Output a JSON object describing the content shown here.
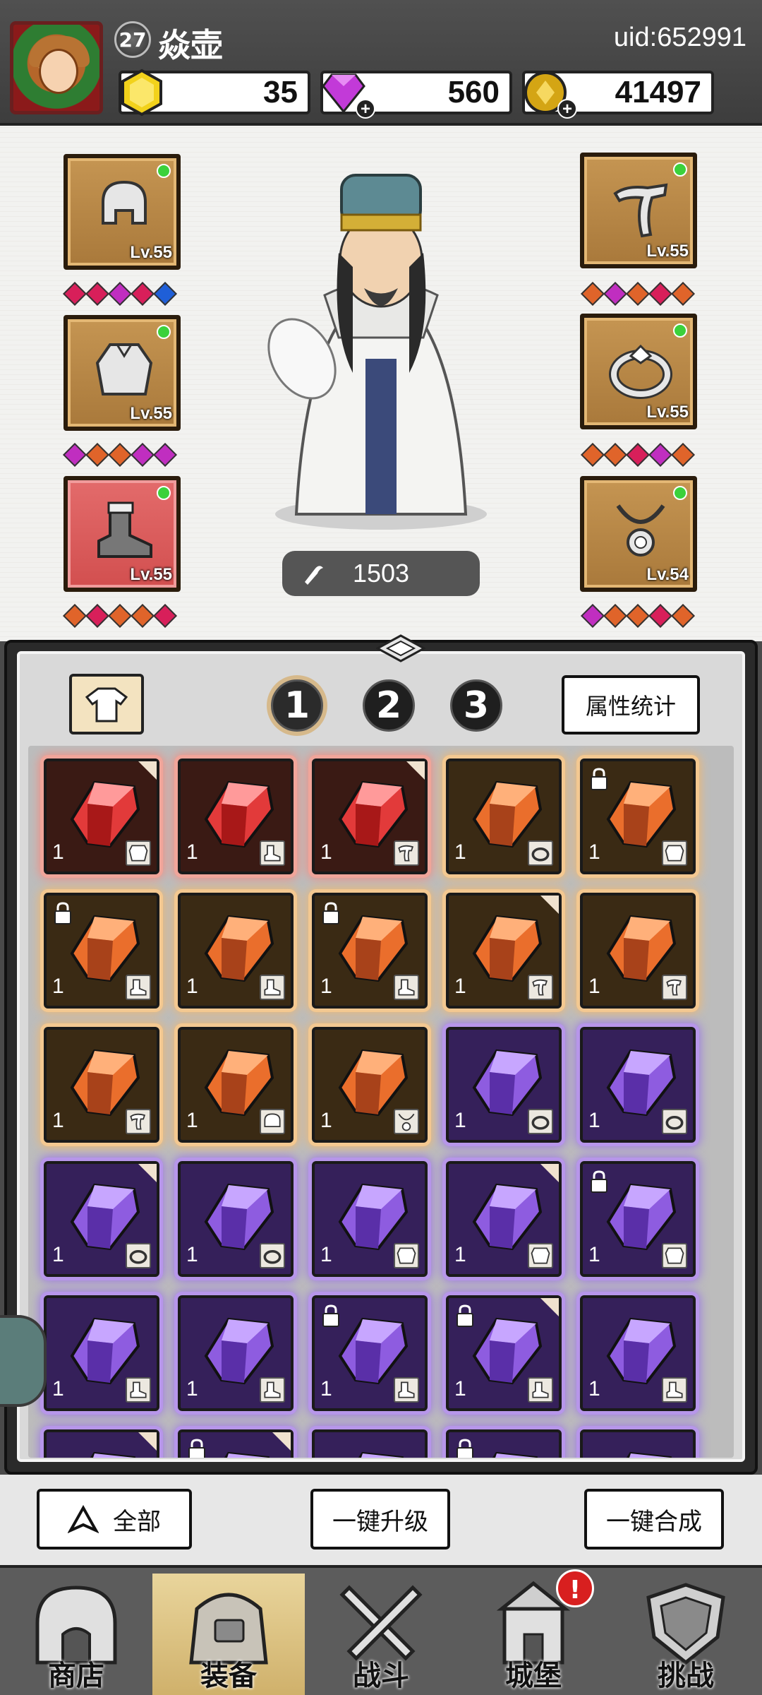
{
  "player": {
    "level": "27",
    "name": "焱壶",
    "uid": "uid:652991"
  },
  "currencies": {
    "gold": "35",
    "diamond": "560",
    "coin": "41497"
  },
  "equipment": {
    "left": [
      {
        "slot": "helmet",
        "level": "Lv.55",
        "gems": [
          "#d81f5a",
          "#d81f5a",
          "#c02ec0",
          "#d81f5a",
          "#1f5fd8"
        ]
      },
      {
        "slot": "armor",
        "level": "Lv.55",
        "gems": [
          "#c02ec0",
          "#e0642a",
          "#e0642a",
          "#c02ec0",
          "#c02ec0"
        ]
      },
      {
        "slot": "boots",
        "level": "Lv.55",
        "gems": [
          "#e0642a",
          "#d81f5a",
          "#e0642a",
          "#e0642a",
          "#d81f5a"
        ]
      }
    ],
    "right": [
      {
        "slot": "weapon",
        "level": "Lv.55",
        "gems": [
          "#e0642a",
          "#c02ec0",
          "#e0642a",
          "#d81f5a",
          "#e0642a"
        ]
      },
      {
        "slot": "ring",
        "level": "Lv.55",
        "gems": [
          "#e0642a",
          "#e0642a",
          "#d81f5a",
          "#c02ec0",
          "#e0642a"
        ]
      },
      {
        "slot": "necklace",
        "level": "Lv.54",
        "gems": [
          "#c02ec0",
          "#e0642a",
          "#e0642a",
          "#d81f5a",
          "#e0642a"
        ]
      }
    ]
  },
  "power": "1503",
  "bag": {
    "tabs": [
      "1",
      "2",
      "3"
    ],
    "active_tab": "1",
    "attr_button": "属性统计",
    "items": [
      {
        "rarity": "red",
        "count": "1",
        "sub": "armor",
        "lock": false,
        "corner": true
      },
      {
        "rarity": "red",
        "count": "1",
        "sub": "boots",
        "lock": false,
        "corner": false
      },
      {
        "rarity": "red",
        "count": "1",
        "sub": "weapon",
        "lock": false,
        "corner": true
      },
      {
        "rarity": "orange",
        "count": "1",
        "sub": "ring",
        "lock": false,
        "corner": false
      },
      {
        "rarity": "orange",
        "count": "1",
        "sub": "armor",
        "lock": true,
        "corner": false
      },
      {
        "rarity": "orange",
        "count": "1",
        "sub": "boots",
        "lock": true,
        "corner": false
      },
      {
        "rarity": "orange",
        "count": "1",
        "sub": "boots",
        "lock": false,
        "corner": false
      },
      {
        "rarity": "orange",
        "count": "1",
        "sub": "boots",
        "lock": true,
        "corner": false
      },
      {
        "rarity": "orange",
        "count": "1",
        "sub": "weapon",
        "lock": false,
        "corner": true
      },
      {
        "rarity": "orange",
        "count": "1",
        "sub": "weapon",
        "lock": false,
        "corner": false
      },
      {
        "rarity": "orange",
        "count": "1",
        "sub": "weapon",
        "lock": false,
        "corner": false
      },
      {
        "rarity": "orange",
        "count": "1",
        "sub": "helmet",
        "lock": false,
        "corner": false
      },
      {
        "rarity": "orange",
        "count": "1",
        "sub": "necklace",
        "lock": false,
        "corner": false
      },
      {
        "rarity": "purple",
        "count": "1",
        "sub": "ring",
        "lock": false,
        "corner": false
      },
      {
        "rarity": "purple",
        "count": "1",
        "sub": "ring",
        "lock": false,
        "corner": false
      },
      {
        "rarity": "purple",
        "count": "1",
        "sub": "ring",
        "lock": false,
        "corner": true
      },
      {
        "rarity": "purple",
        "count": "1",
        "sub": "ring",
        "lock": false,
        "corner": false
      },
      {
        "rarity": "purple",
        "count": "1",
        "sub": "armor",
        "lock": false,
        "corner": false
      },
      {
        "rarity": "purple",
        "count": "1",
        "sub": "armor",
        "lock": false,
        "corner": true
      },
      {
        "rarity": "purple",
        "count": "1",
        "sub": "armor",
        "lock": true,
        "corner": false
      },
      {
        "rarity": "purple",
        "count": "1",
        "sub": "boots",
        "lock": false,
        "corner": false
      },
      {
        "rarity": "purple",
        "count": "1",
        "sub": "boots",
        "lock": false,
        "corner": false
      },
      {
        "rarity": "purple",
        "count": "1",
        "sub": "boots",
        "lock": true,
        "corner": false
      },
      {
        "rarity": "purple",
        "count": "1",
        "sub": "boots",
        "lock": true,
        "corner": true
      },
      {
        "rarity": "purple",
        "count": "1",
        "sub": "boots",
        "lock": false,
        "corner": false
      },
      {
        "rarity": "purple",
        "count": "",
        "sub": "",
        "lock": false,
        "corner": true
      },
      {
        "rarity": "purple",
        "count": "",
        "sub": "",
        "lock": true,
        "corner": true
      },
      {
        "rarity": "purple",
        "count": "",
        "sub": "",
        "lock": false,
        "corner": false
      },
      {
        "rarity": "purple",
        "count": "",
        "sub": "",
        "lock": true,
        "corner": false
      },
      {
        "rarity": "purple",
        "count": "",
        "sub": "",
        "lock": false,
        "corner": false
      }
    ]
  },
  "actions": {
    "all": "全部",
    "upgrade_all": "一键升级",
    "merge_all": "一键合成"
  },
  "nav": [
    {
      "label": "商店",
      "icon": "shop-icon"
    },
    {
      "label": "装备",
      "icon": "bag-icon"
    },
    {
      "label": "战斗",
      "icon": "swords-icon"
    },
    {
      "label": "城堡",
      "icon": "castle-icon"
    },
    {
      "label": "挑战",
      "icon": "shield-icon"
    }
  ],
  "nav_active": "装备",
  "castle_alert": "!",
  "colors": {
    "red_rarity": "#f58d80",
    "orange_rarity": "#f0b870",
    "purple_rarity": "#9c78e4",
    "status_dot": "#3bd13b"
  }
}
